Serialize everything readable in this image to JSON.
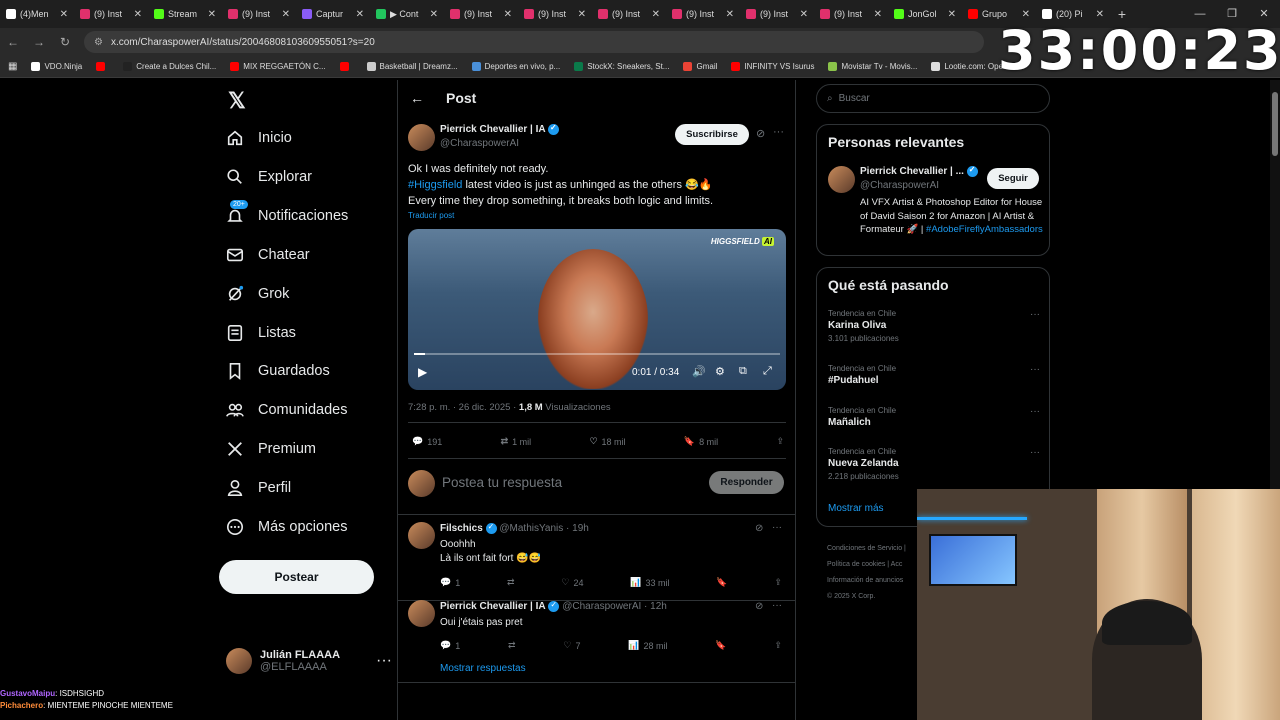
{
  "tabs": [
    {
      "label": "(4)Men",
      "color": "#ffffff",
      "icon": "tiktok-icon"
    },
    {
      "label": "(9) Inst",
      "color": "#e1306c",
      "icon": "instagram-icon"
    },
    {
      "label": "Stream",
      "color": "#53fc18",
      "icon": "kick-icon"
    },
    {
      "label": "(9) Inst",
      "color": "#e1306c",
      "icon": "instagram-icon"
    },
    {
      "label": "Captur",
      "color": "#8a5cf6",
      "icon": "pen-icon"
    },
    {
      "label": "▶ Cont",
      "color": "#22c55e",
      "icon": "loading-icon"
    },
    {
      "label": "(9) Inst",
      "color": "#e1306c",
      "icon": "instagram-icon"
    },
    {
      "label": "(9) Inst",
      "color": "#e1306c",
      "icon": "instagram-icon"
    },
    {
      "label": "(9) Inst",
      "color": "#e1306c",
      "icon": "instagram-icon"
    },
    {
      "label": "(9) Inst",
      "color": "#e1306c",
      "icon": "instagram-icon"
    },
    {
      "label": "(9) Inst",
      "color": "#e1306c",
      "icon": "instagram-icon"
    },
    {
      "label": "(9) Inst",
      "color": "#e1306c",
      "icon": "instagram-icon"
    },
    {
      "label": "JonGol",
      "color": "#53fc18",
      "icon": "kick-icon"
    },
    {
      "label": "Grupo",
      "color": "#ff0000",
      "icon": "youtube-icon"
    },
    {
      "label": "(20) Pi",
      "color": "#ffffff",
      "icon": "x-icon"
    }
  ],
  "url": "x.com/CharaspowerAI/status/2004680810360955051?s=20",
  "bookmarks": [
    {
      "label": "VDO.Ninja",
      "color": "#ffffff"
    },
    {
      "label": "",
      "color": "#ff0000"
    },
    {
      "label": "Create a Dulces Chil...",
      "color": "#222222"
    },
    {
      "label": "MIX REGGAETÓN C...",
      "color": "#ff0000"
    },
    {
      "label": "",
      "color": "#ff0000"
    },
    {
      "label": "Basketball | Dreamz...",
      "color": "#cccccc"
    },
    {
      "label": "Deportes en vivo, p...",
      "color": "#4a90d9"
    },
    {
      "label": "StockX: Sneakers, St...",
      "color": "#0a7a4a"
    },
    {
      "label": "Gmail",
      "color": "#ea4335"
    },
    {
      "label": "INFINITY VS Isurus",
      "color": "#ff0000"
    },
    {
      "label": "Movistar Tv - Movis...",
      "color": "#8bc34a"
    },
    {
      "label": "Lootie.com: Open...",
      "color": "#dddddd"
    }
  ],
  "timer": "33:00:23",
  "sidebar": {
    "items": [
      {
        "label": "Inicio",
        "icon": "home-icon"
      },
      {
        "label": "Explorar",
        "icon": "search-icon"
      },
      {
        "label": "Notificaciones",
        "icon": "bell-icon",
        "badge": "20+"
      },
      {
        "label": "Chatear",
        "icon": "mail-icon"
      },
      {
        "label": "Grok",
        "icon": "grok-icon"
      },
      {
        "label": "Listas",
        "icon": "list-icon"
      },
      {
        "label": "Guardados",
        "icon": "bookmark-icon"
      },
      {
        "label": "Comunidades",
        "icon": "people-icon"
      },
      {
        "label": "Premium",
        "icon": "x-icon"
      },
      {
        "label": "Perfil",
        "icon": "user-icon"
      },
      {
        "label": "Más opciones",
        "icon": "more-circle-icon"
      }
    ],
    "post_button": "Postear",
    "account": {
      "name": "Julián FLAAAA",
      "handle": "@ELFLAAAA"
    }
  },
  "post": {
    "header": "Post",
    "author": "Pierrick Chevallier | IA",
    "handle": "@CharaspowerAI",
    "subscribe": "Suscribirse",
    "line1": "Ok I was definitely not ready.",
    "hashtag": "#Higgsfield",
    "line2_rest": " latest video is just as unhinged as the others 😂🔥",
    "line3": "Every time they drop something, it breaks both logic and limits.",
    "translate": "Traducir post",
    "video": {
      "watermark": "HIGGSFIELD",
      "time": "0:01 / 0:34",
      "progress": 0.03
    },
    "meta_time": "7:28 p. m. · 26 dic. 2025 · ",
    "views_count": "1,8 M",
    "views_label": " Visualizaciones",
    "stats": {
      "replies": "191",
      "reposts": "1 mil",
      "likes": "18 mil",
      "bookmarks": "8 mil"
    },
    "reply_placeholder": "Postea tu respuesta",
    "reply_button": "Responder"
  },
  "replies": [
    {
      "name": "Filschics",
      "handle": "@MathisYanis · 19h",
      "line1": "Ooohhh",
      "line2": "Là ils ont fait fort 😅😅",
      "stats": {
        "replies": "1",
        "reposts": "",
        "likes": "24",
        "views": "33 mil"
      }
    },
    {
      "name": "Pierrick Chevallier | IA",
      "handle": "@CharaspowerAI · 12h",
      "line1": "Oui j'étais pas pret",
      "stats": {
        "replies": "1",
        "reposts": "",
        "likes": "7",
        "views": "28 mil"
      }
    }
  ],
  "show_replies": "Mostrar respuestas",
  "right": {
    "search_placeholder": "Buscar",
    "relevant_title": "Personas relevantes",
    "relevant": {
      "name": "Pierrick Chevallier | ...",
      "handle": "@CharaspowerAI",
      "follow": "Seguir",
      "bio": "AI VFX Artist & Photoshop Editor for House of David Saison 2 for Amazon | AI Artist & Formateur 🚀 |",
      "bio_tag": "#AdobeFireflyAmbassadors"
    },
    "trends_title": "Qué está pasando",
    "trends": [
      {
        "context": "Tendencia en Chile",
        "name": "Karina Oliva",
        "count": "3.101 publicaciones"
      },
      {
        "context": "Tendencia en Chile",
        "name": "#Pudahuel",
        "count": ""
      },
      {
        "context": "Tendencia en Chile",
        "name": "Mañalich",
        "count": ""
      },
      {
        "context": "Tendencia en Chile",
        "name": "Nueva Zelanda",
        "count": "2.218 publicaciones"
      }
    ],
    "show_more": "Mostrar más",
    "footer1": "Condiciones de Servicio  |",
    "footer2": "Política de cookies  |  Acc",
    "footer3": "Información de anuncios",
    "footer4": "© 2025 X Corp."
  },
  "chat": [
    {
      "user": "GustavoMaipu",
      "msg": ": ISDHSIGHD",
      "color": "#b066ff"
    },
    {
      "user": "Pichachero",
      "msg": ": MIENTEME PINOCHE MIENTEME",
      "color": "#ff8c3a"
    }
  ]
}
